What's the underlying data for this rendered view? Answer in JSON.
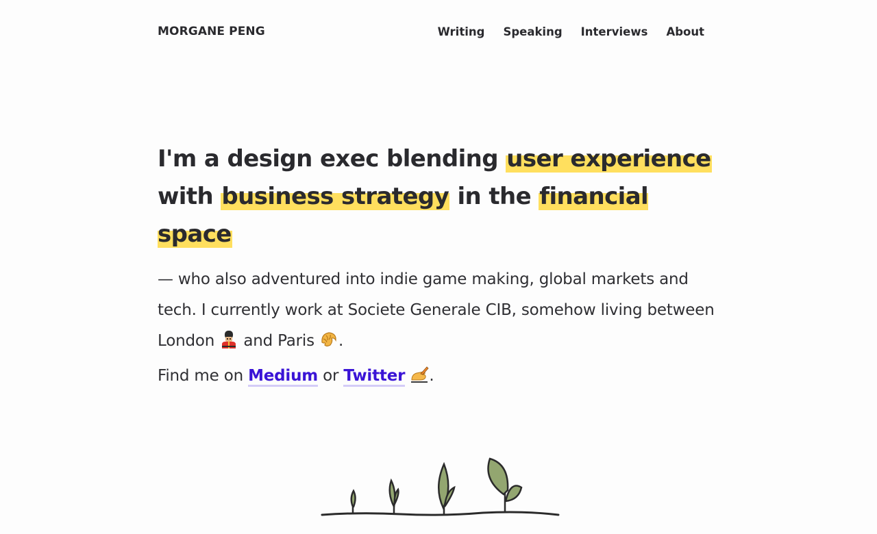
{
  "header": {
    "site_name": "MORGANE PENG",
    "nav": [
      {
        "label": "Writing"
      },
      {
        "label": "Speaking"
      },
      {
        "label": "Interviews"
      },
      {
        "label": "About"
      }
    ]
  },
  "intro": {
    "headline": {
      "t1": "I'm a design exec blending ",
      "h1": "user experience",
      "t2": " with ",
      "h2": "business strategy",
      "t3": " in the ",
      "h3": "financial space"
    },
    "bio": {
      "t1": "— who also adventured into indie game making, global markets and tech. I currently work at Societe Generale CIB, somehow living between London ",
      "emoji_london": "guard-emoji",
      "t2": " and Paris ",
      "emoji_paris": "croissant-emoji",
      "t3": "."
    }
  },
  "find": {
    "prefix": "Find me on ",
    "medium": "Medium",
    "or": " or ",
    "twitter": "Twitter",
    "emoji": "writing-hand-emoji",
    "suffix": "."
  },
  "colors": {
    "highlight": "#ffdf5e",
    "link": "#3a14d6",
    "link_underline": "#d4ccf7",
    "text": "#2a2a2e",
    "leaf": "#93a670"
  }
}
